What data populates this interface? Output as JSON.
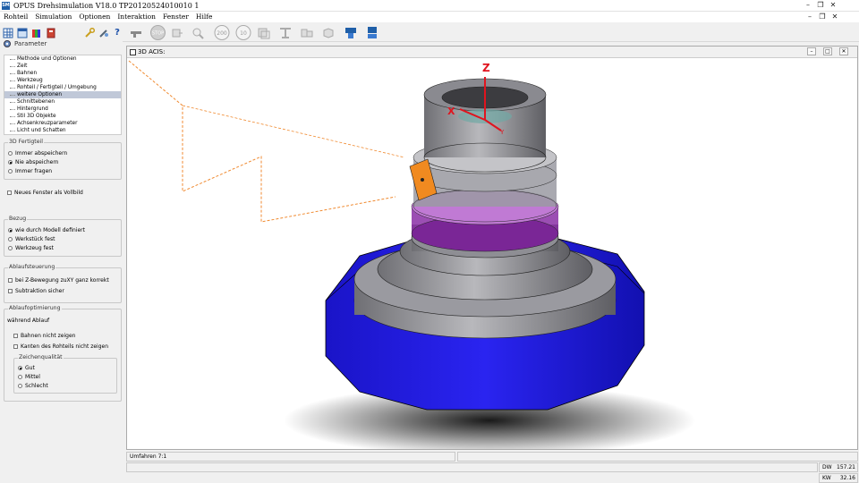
{
  "window": {
    "title": "OPUS Drehsimulation V18.0  TP20120524010010 1",
    "icon_label": "SM"
  },
  "menu": [
    "Rohteil",
    "Simulation",
    "Optionen",
    "Interaktion",
    "Fenster",
    "Hilfe"
  ],
  "toolbar": {
    "btn_stop": "STOP",
    "btn_200": "200",
    "btn_10": "10"
  },
  "sidebar": {
    "header": "Parameter",
    "tree": [
      "Methode und Optionen",
      "Zeit",
      "Bahnen",
      "Werkzeug",
      "Rohteil / Fertigteil / Umgebung",
      "weitere Optionen",
      "Schnittebenen",
      "Hintergrund",
      "Stil 3D Objekte",
      "Achsenkreuzparameter",
      "Licht und Schatten"
    ],
    "selected_index": 5,
    "fertigteil": {
      "title": "3D Fertigteil",
      "opts": [
        "Immer abspeichern",
        "Nie abspeichern",
        "Immer fragen"
      ],
      "selected": 1
    },
    "vollbild": "Neues Fenster als Vollbild",
    "bezug": {
      "title": "Bezug",
      "opts": [
        "wie durch Modell definiert",
        "Werkstück fest",
        "Werkzeug fest"
      ],
      "selected": 0
    },
    "ablaufsteuerung": {
      "title": "Ablaufsteuerung",
      "opts": [
        "bei Z-Bewegung zuXY ganz korrekt",
        "Subtraktion sicher"
      ]
    },
    "ablaufoptimierung": {
      "title": "Ablaufoptimierung",
      "sub": "während Ablauf",
      "opts": [
        "Bahnen nicht zeigen",
        "Kanten des Rohteils nicht zeigen"
      ]
    },
    "zeichenqualitaet": {
      "title": "Zeichenqualität",
      "opts": [
        "Gut",
        "Mittel",
        "Schlecht"
      ],
      "selected": 0
    }
  },
  "viewport": {
    "title": "3D ACIS:",
    "axis_labels": [
      "Z",
      "X",
      "Y"
    ]
  },
  "status": {
    "left": "Umfahren 7:1",
    "dw_label": "DW",
    "dw_value": "157.21",
    "kw_label": "KW",
    "kw_value": "32.16"
  },
  "colors": {
    "base": "#1a14d8",
    "gray": "#8a8a8a",
    "purple": "#9b2fb8",
    "orange": "#e67e22",
    "axis": "#e0141e"
  }
}
